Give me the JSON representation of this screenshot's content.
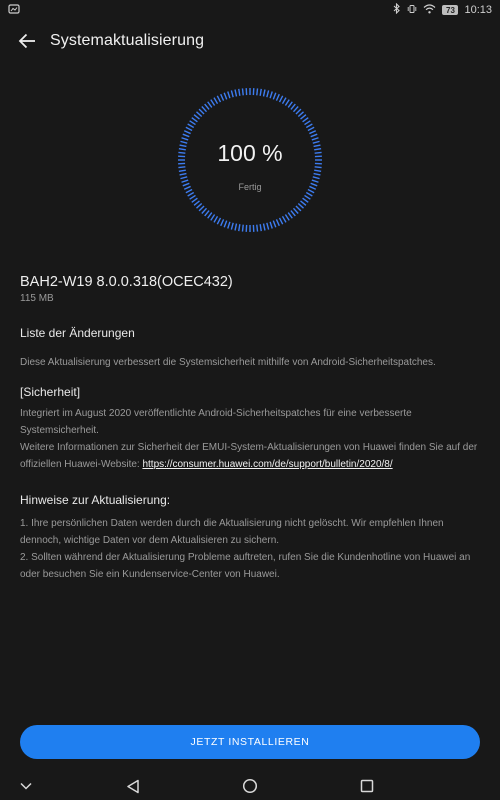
{
  "statusbar": {
    "time": "10:13",
    "battery_level": "73"
  },
  "header": {
    "title": "Systemaktualisierung"
  },
  "progress": {
    "percent_text": "100 %",
    "percent_value": 100,
    "status": "Fertig",
    "accent_color": "#3d7cf0"
  },
  "update": {
    "version": "BAH2-W19 8.0.0.318(OCEC432)",
    "size": "115 MB"
  },
  "changelog": {
    "heading": "Liste der Änderungen",
    "intro": "Diese Aktualisierung verbessert die Systemsicherheit mithilfe von Android-Sicherheitspatches.",
    "security_label": "[Sicherheit]",
    "security_text_1": "Integriert im August 2020 veröffentlichte Android-Sicherheitspatches für eine verbesserte Systemsicherheit.",
    "security_text_2": "Weitere Informationen zur Sicherheit der EMUI-System-Aktualisierungen von Huawei finden Sie auf der offiziellen Huawei-Website: ",
    "security_link": "https://consumer.huawei.com/de/support/bulletin/2020/8/"
  },
  "notes": {
    "heading": "Hinweise zur Aktualisierung:",
    "item_1": "1. Ihre persönlichen Daten werden durch die Aktualisierung nicht gelöscht. Wir empfehlen Ihnen dennoch, wichtige Daten vor dem Aktualisieren zu sichern.",
    "item_2": "2. Sollten während der Aktualisierung Probleme auftreten, rufen Sie die Kundenhotline von Huawei an oder besuchen Sie ein Kundenservice-Center von Huawei."
  },
  "actions": {
    "install_label": "JETZT INSTALLIEREN",
    "button_color": "#1f7ff0"
  },
  "navbar": {
    "icons": [
      "chevron-down-icon",
      "back-triangle-icon",
      "home-circle-icon",
      "recents-square-icon"
    ]
  }
}
